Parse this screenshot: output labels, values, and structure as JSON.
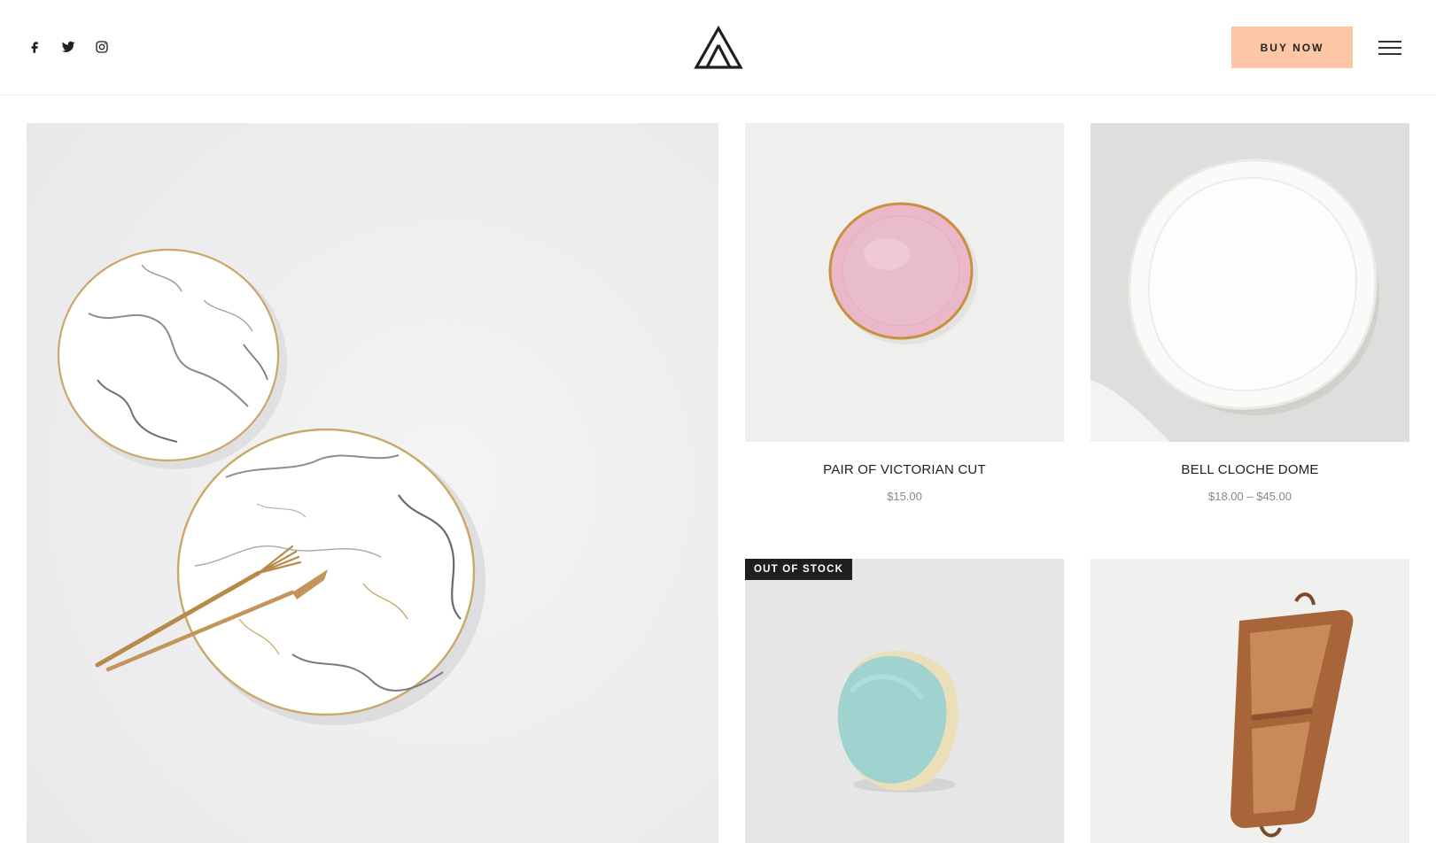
{
  "header": {
    "social": [
      {
        "icon": "facebook-icon"
      },
      {
        "icon": "twitter-icon"
      },
      {
        "icon": "instagram-icon"
      }
    ],
    "logo_icon": "triangle-logo-icon",
    "buy_label": "BUY NOW",
    "menu_icon": "hamburger-menu-icon",
    "accent_color": "#fdc6a4"
  },
  "products": [
    {
      "name": "PAIR OF VICTORIAN CUT",
      "price": "$15.00"
    },
    {
      "name": "BELL CLOCHE DOME",
      "price": "$18.00 – $45.00"
    },
    {
      "badge": "OUT OF STOCK"
    }
  ]
}
